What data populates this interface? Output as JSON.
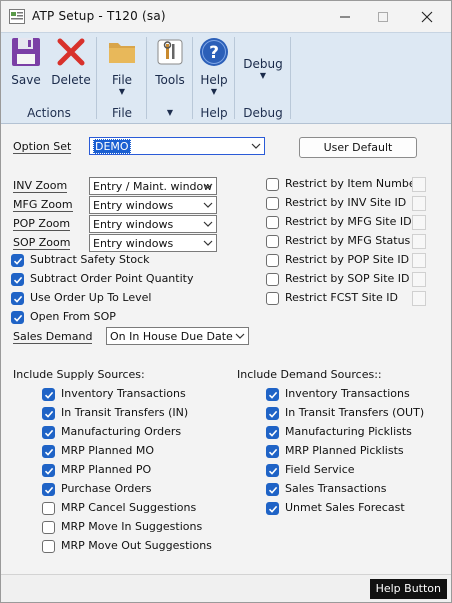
{
  "window": {
    "title": "ATP Setup  -  T120 (sa)"
  },
  "ribbon": {
    "groups": [
      {
        "label": "Actions",
        "buttons": [
          {
            "label": "Save",
            "icon": "save-icon"
          },
          {
            "label": "Delete",
            "icon": "delete-icon"
          }
        ]
      },
      {
        "label": "File",
        "buttons": [
          {
            "label": "File",
            "icon": "folder-icon"
          }
        ]
      },
      {
        "label": "",
        "buttons": [
          {
            "label": "Tools",
            "icon": "tools-icon"
          }
        ]
      },
      {
        "label": "Help",
        "buttons": [
          {
            "label": "Help",
            "icon": "help-icon"
          }
        ]
      },
      {
        "label": "Debug",
        "buttons": [
          {
            "label": "Debug",
            "icon": "debug-icon"
          }
        ]
      }
    ],
    "accent": "#dde8f3"
  },
  "option_set": {
    "label": "Option Set",
    "value": "DEMO"
  },
  "user_default_label": "User Default",
  "zooms": [
    {
      "label": "INV Zoom",
      "value": "Entry / Maint. window"
    },
    {
      "label": "MFG Zoom",
      "value": "Entry windows"
    },
    {
      "label": "POP Zoom",
      "value": "Entry windows"
    },
    {
      "label": "SOP Zoom",
      "value": "Entry windows"
    }
  ],
  "left_checks": [
    {
      "label": "Subtract Safety Stock",
      "checked": true
    },
    {
      "label": "Subtract Order Point Quantity",
      "checked": true
    },
    {
      "label": "Use Order Up To Level",
      "checked": true
    },
    {
      "label": "Open From SOP",
      "checked": true
    }
  ],
  "sales_demand": {
    "label": "Sales Demand",
    "value": "On In House Due Date"
  },
  "restrict_checks": [
    {
      "label": "Restrict by Item Number",
      "checked": false
    },
    {
      "label": "Restrict by INV Site ID",
      "checked": false
    },
    {
      "label": "Restrict by MFG Site ID",
      "checked": false
    },
    {
      "label": "Restrict by MFG Status",
      "checked": false
    },
    {
      "label": "Restrict by POP Site ID",
      "checked": false
    },
    {
      "label": "Restrict by SOP Site ID",
      "checked": false
    },
    {
      "label": "Restrict FCST Site ID",
      "checked": false
    }
  ],
  "supply": {
    "title": "Include Supply Sources:",
    "items": [
      {
        "label": "Inventory Transactions",
        "checked": true
      },
      {
        "label": "In Transit Transfers (IN)",
        "checked": true
      },
      {
        "label": "Manufacturing Orders",
        "checked": true
      },
      {
        "label": "MRP Planned MO",
        "checked": true
      },
      {
        "label": "MRP Planned PO",
        "checked": true
      },
      {
        "label": "Purchase Orders",
        "checked": true
      },
      {
        "label": "MRP Cancel Suggestions",
        "checked": false
      },
      {
        "label": "MRP Move In Suggestions",
        "checked": false
      },
      {
        "label": "MRP Move Out Suggestions",
        "checked": false
      }
    ]
  },
  "demand": {
    "title": "Include Demand Sources::",
    "items": [
      {
        "label": "Inventory Transactions",
        "checked": true
      },
      {
        "label": "In Transit Transfers (OUT)",
        "checked": true
      },
      {
        "label": "Manufacturing Picklists",
        "checked": true
      },
      {
        "label": "MRP Planned Picklists",
        "checked": true
      },
      {
        "label": "Field Service",
        "checked": true
      },
      {
        "label": "Sales Transactions",
        "checked": true
      },
      {
        "label": "Unmet Sales Forecast",
        "checked": true
      }
    ]
  },
  "help_button_label": "Help Button"
}
